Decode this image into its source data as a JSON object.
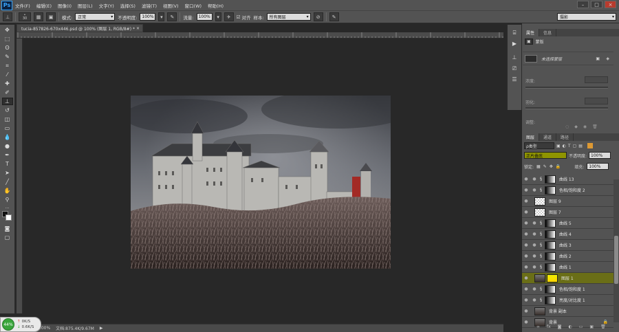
{
  "app": {
    "logo": "Ps"
  },
  "menu": [
    "文件(F)",
    "编辑(E)",
    "图像(I)",
    "图层(L)",
    "文字(Y)",
    "选择(S)",
    "滤镜(T)",
    "视图(V)",
    "窗口(W)",
    "帮助(H)"
  ],
  "window_buttons": {
    "minimize": "–",
    "maximize": "□",
    "close": "×"
  },
  "options": {
    "brush_size": "30",
    "mode_label": "模式:",
    "mode_value": "正常",
    "opacity_label": "不透明度:",
    "opacity_value": "100%",
    "flow_label": "流量:",
    "flow_value": "100%",
    "aligned_label": "对齐",
    "sample_label": "样本:",
    "sample_value": "所有图层",
    "workspace": "摄影"
  },
  "document": {
    "tab_title": "tucia-857826-670x446.psd @ 100% (图层 1, RGB/8#) *",
    "close": "×",
    "status_zoom": "100%",
    "status_doc": "文档:875.4K/9.67M"
  },
  "network": {
    "up": "0K/S",
    "down": "0.6K/S",
    "percent": "44%"
  },
  "properties": {
    "tabs": [
      "属性",
      "信息"
    ],
    "mask_title": "蒙版",
    "no_mask": "未选择蒙版",
    "density_label": "浓度:",
    "feather_label": "羽化:",
    "adjust_label": "调整:"
  },
  "layers_panel": {
    "tabs": [
      "图层",
      "通道",
      "路径"
    ],
    "filter_kind": "ρ类型",
    "blend_mode": "正片叠底",
    "opacity_label": "不透明度:",
    "opacity_value": "100%",
    "lock_label": "锁定:",
    "fill_label": "填充:",
    "fill_value": "100%",
    "layers": [
      {
        "name": "曲线 13",
        "kind": "adjust"
      },
      {
        "name": "色相/饱和度 2",
        "kind": "adjust"
      },
      {
        "name": "图层 9",
        "kind": "transparent"
      },
      {
        "name": "图层 7",
        "kind": "transparent"
      },
      {
        "name": "曲线 5",
        "kind": "adjust"
      },
      {
        "name": "曲线 4",
        "kind": "adjust"
      },
      {
        "name": "曲线 3",
        "kind": "adjust"
      },
      {
        "name": "曲线 2",
        "kind": "adjust"
      },
      {
        "name": "曲线 1",
        "kind": "adjust"
      },
      {
        "name": "图层 1",
        "kind": "image",
        "selected": true
      },
      {
        "name": "色相/饱和度 1",
        "kind": "adjust"
      },
      {
        "name": "亮度/对比度 1",
        "kind": "adjust"
      },
      {
        "name": "背景 副本",
        "kind": "image"
      },
      {
        "name": "背景",
        "kind": "image",
        "locked": true
      }
    ]
  },
  "colors": {
    "selected_layer": "#6a6e17",
    "blend_highlight": "#a7ab00"
  }
}
